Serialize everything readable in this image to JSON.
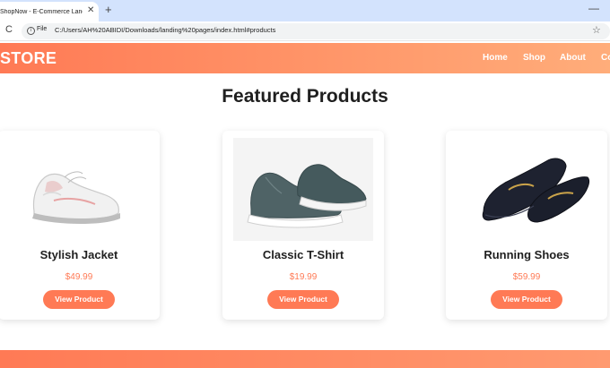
{
  "browser": {
    "tab_title": "ShopNow - E-Commerce Landi",
    "tab_close": "✕",
    "new_tab": "+",
    "minimize": "—",
    "reload": "C",
    "file_chip": "File",
    "url": "C:/Users/AH%20ABIDI/Downloads/landing%20pages/index.html#products",
    "star": "☆"
  },
  "header": {
    "logo": "STORE",
    "nav": [
      "Home",
      "Shop",
      "About",
      "Co"
    ]
  },
  "main": {
    "title": "Featured Products",
    "products": [
      {
        "name": "Stylish Jacket",
        "price": "$49.99",
        "button": "View Product",
        "icon": "white-sneaker-icon"
      },
      {
        "name": "Classic T-Shirt",
        "price": "$19.99",
        "button": "View Product",
        "icon": "slip-on-sneaker-icon"
      },
      {
        "name": "Running Shoes",
        "price": "$59.99",
        "button": "View Product",
        "icon": "loafer-shoes-icon"
      }
    ]
  },
  "colors": {
    "accent": "#ff7a55",
    "accent_light": "#ffad7a",
    "tabstrip": "#d3e3fd"
  }
}
